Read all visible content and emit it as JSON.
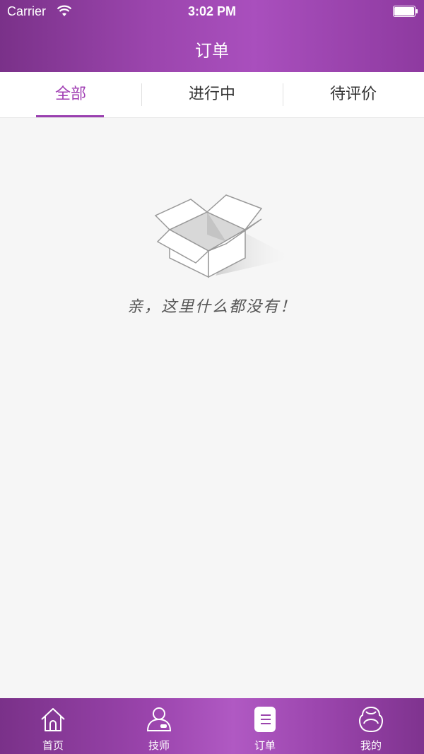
{
  "status_bar": {
    "carrier": "Carrier",
    "time": "3:02 PM"
  },
  "header": {
    "title": "订单"
  },
  "tabs": [
    {
      "label": "全部",
      "active": true
    },
    {
      "label": "进行中",
      "active": false
    },
    {
      "label": "待评价",
      "active": false
    }
  ],
  "empty_state": {
    "icon": "empty-box-icon",
    "message": "亲，这里什么都没有！"
  },
  "bottom_nav": [
    {
      "label": "首页",
      "icon": "home-icon"
    },
    {
      "label": "技师",
      "icon": "technician-icon"
    },
    {
      "label": "订单",
      "icon": "orders-icon",
      "active": true
    },
    {
      "label": "我的",
      "icon": "profile-icon"
    }
  ],
  "colors": {
    "accent": "#a03db3",
    "bar_purple": "#9b45ad",
    "background": "#f6f6f6"
  }
}
